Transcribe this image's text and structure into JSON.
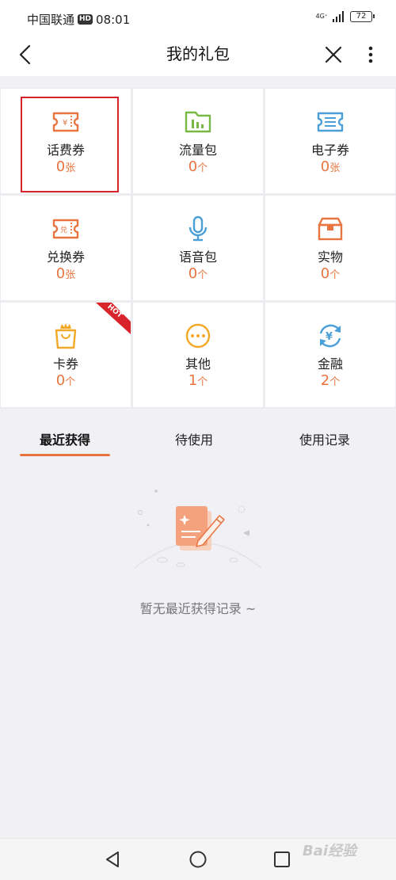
{
  "status_bar": {
    "carrier": "中国联通",
    "hd_badge": "HD",
    "time": "08:01",
    "network": "4G⁺",
    "battery": "72"
  },
  "nav": {
    "title": "我的礼包",
    "back_icon": "chevron-left-icon",
    "close_icon": "close-icon",
    "more_icon": "more-vertical-icon"
  },
  "categories": [
    {
      "label": "话费券",
      "count": "0",
      "unit": "张",
      "icon": "voucher-yuan-icon",
      "color": "#e8743f"
    },
    {
      "label": "流量包",
      "count": "0",
      "unit": "个",
      "icon": "bar-chart-folder-icon",
      "color": "#78b845"
    },
    {
      "label": "电子券",
      "count": "0",
      "unit": "张",
      "icon": "ticket-lines-icon",
      "color": "#4a9fd8"
    },
    {
      "label": "兑换券",
      "count": "0",
      "unit": "张",
      "icon": "exchange-ticket-icon",
      "color": "#e8743f"
    },
    {
      "label": "语音包",
      "count": "0",
      "unit": "个",
      "icon": "microphone-icon",
      "color": "#4a9fd8"
    },
    {
      "label": "实物",
      "count": "0",
      "unit": "个",
      "icon": "gift-box-icon",
      "color": "#e8743f"
    },
    {
      "label": "卡券",
      "count": "0",
      "unit": "个",
      "icon": "shopping-bag-crown-icon",
      "color": "#f2a825",
      "badge": "HOT"
    },
    {
      "label": "其他",
      "count": "1",
      "unit": "个",
      "icon": "more-dots-circle-icon",
      "color": "#f2a825"
    },
    {
      "label": "金融",
      "count": "2",
      "unit": "个",
      "icon": "yuan-refresh-icon",
      "color": "#4a9fd8"
    }
  ],
  "tabs": [
    {
      "label": "最近获得",
      "active": true
    },
    {
      "label": "待使用",
      "active": false
    },
    {
      "label": "使用记录",
      "active": false
    }
  ],
  "empty_state": {
    "text": "暂无最近获得记录 ~",
    "icon": "empty-document-pen-icon"
  },
  "system_nav": {
    "back_icon": "triangle-back-icon",
    "home_icon": "circle-home-icon",
    "recent_icon": "square-recent-icon"
  },
  "watermark": "Bai经验",
  "colors": {
    "accent": "#e8743f",
    "selection": "#d8232a",
    "hot_badge": "#d8232a"
  }
}
